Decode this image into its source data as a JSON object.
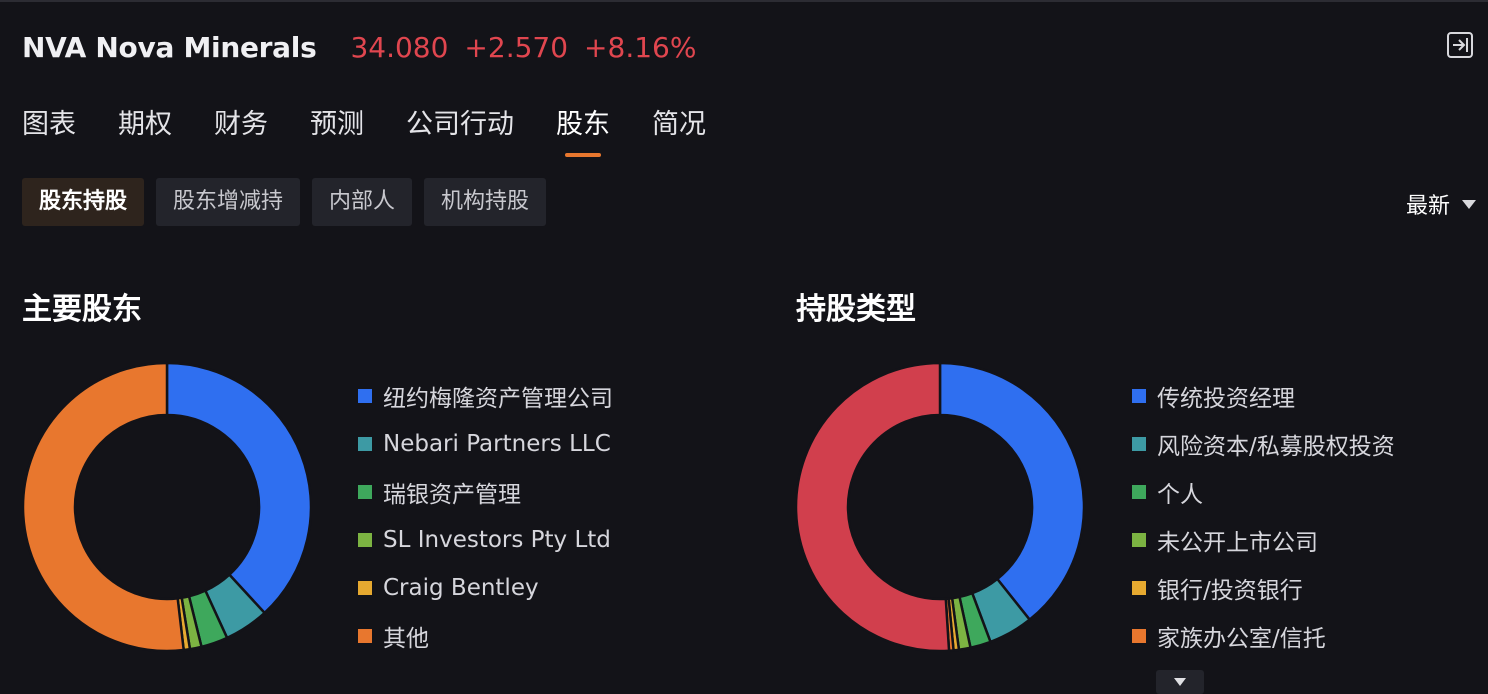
{
  "header": {
    "ticker": "NVA Nova Minerals",
    "price": "34.080",
    "change": "+2.570",
    "change_pct": "+8.16%",
    "price_color": "#e0464f",
    "exit_icon": "exit-panel-icon"
  },
  "tabs": [
    {
      "label": "图表",
      "active": false
    },
    {
      "label": "期权",
      "active": false
    },
    {
      "label": "财务",
      "active": false
    },
    {
      "label": "预测",
      "active": false
    },
    {
      "label": "公司行动",
      "active": false
    },
    {
      "label": "股东",
      "active": true
    },
    {
      "label": "简况",
      "active": false
    }
  ],
  "subtabs": [
    {
      "label": "股东持股",
      "active": true
    },
    {
      "label": "股东增减持",
      "active": false
    },
    {
      "label": "内部人",
      "active": false
    },
    {
      "label": "机构持股",
      "active": false
    }
  ],
  "sort": {
    "label": "最新"
  },
  "shareholders": {
    "title": "主要股东",
    "items": [
      {
        "label": "纽约梅隆资产管理公司",
        "color": "#2f6ff0",
        "share": 0.3815
      },
      {
        "label": "Nebari Partners LLC",
        "color": "#3d9aa4",
        "share": 0.05
      },
      {
        "label": "瑞银资产管理",
        "color": "#3ea85c",
        "share": 0.03
      },
      {
        "label": "SL Investors Pty Ltd",
        "color": "#7cb342",
        "share": 0.013
      },
      {
        "label": "Craig Bentley",
        "color": "#e6a930",
        "share": 0.007
      },
      {
        "label": "其他",
        "color": "#e8772e",
        "share": 0.5185
      }
    ]
  },
  "holding_types": {
    "title": "持股类型",
    "items": [
      {
        "label": "传统投资经理",
        "color": "#2f6ff0",
        "share": 0.393
      },
      {
        "label": "风险资本/私募股权投资",
        "color": "#3d9aa4",
        "share": 0.05
      },
      {
        "label": "个人",
        "color": "#3ea85c",
        "share": 0.023
      },
      {
        "label": "未公开上市公司",
        "color": "#7cb342",
        "share": 0.013
      },
      {
        "label": "银行/投资银行",
        "color": "#e6a930",
        "share": 0.006
      },
      {
        "label": "家族办公室/信托",
        "color": "#e8772e",
        "share": 0.005
      },
      {
        "label": "",
        "color": "#d13f4d",
        "share": 0.51
      }
    ]
  }
}
